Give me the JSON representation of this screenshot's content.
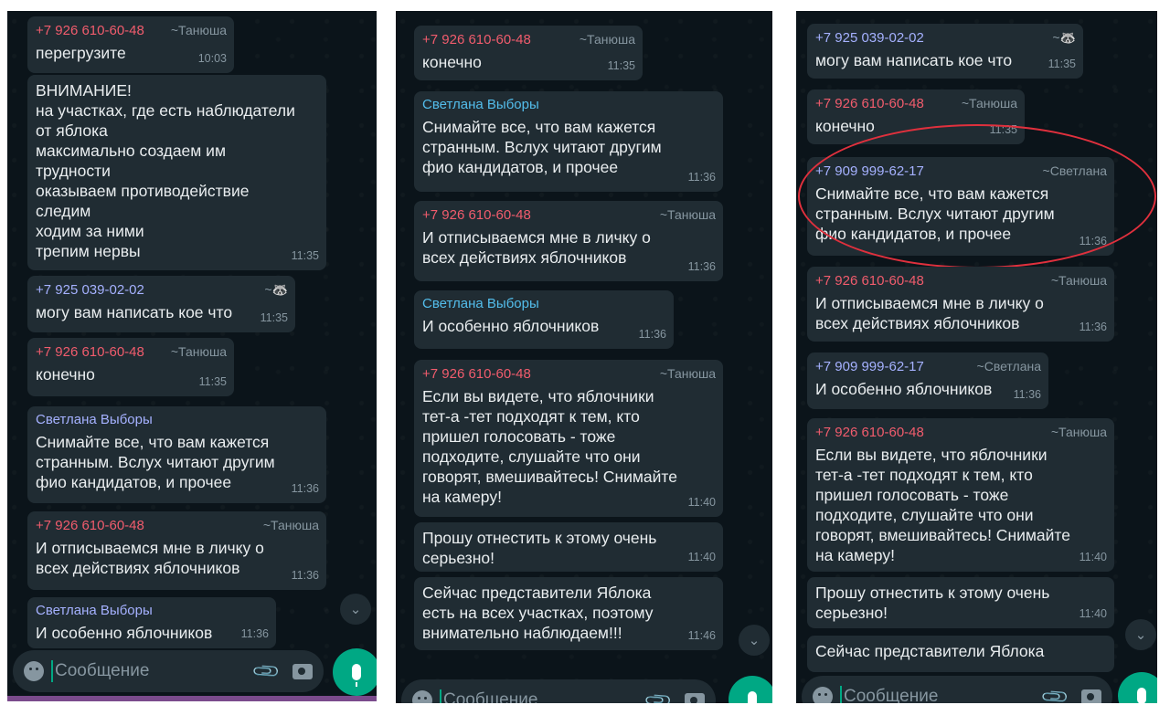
{
  "panels": [
    {
      "messages": [
        {
          "num": "+7 926 610-60-48",
          "alias": "~Танюша",
          "text": "перегрузите",
          "time": "10:03"
        },
        {
          "text": "ВНИМАНИЕ!\nна участках, где есть наблюдатели\nот яблока\nмаксимально создаем им\nтрудности\nоказываем противодействие\nследим\nходим за ними\nтрепим нервы",
          "time": "11:35"
        },
        {
          "num": "+7 925 039-02-02",
          "alias": "~🦝",
          "text": "могу вам написать кое что",
          "time": "11:35"
        },
        {
          "num": "+7 926 610-60-48",
          "alias": "~Танюша",
          "text": "конечно",
          "time": "11:35"
        },
        {
          "sender": "Светлана Выборы",
          "text": "Снимайте все, что вам кажется\nстранным. Вслух читают другим\nфио кандидатов, и прочее",
          "time": "11:36"
        },
        {
          "num": "+7 926 610-60-48",
          "alias": "~Танюша",
          "text": "И отписываемся мне в личку о\nвсех действиях яблочников",
          "time": "11:36"
        },
        {
          "sender": "Светлана Выборы",
          "text": "И особенно яблочников",
          "time": "11:36"
        }
      ],
      "input_placeholder": "Сообщение"
    },
    {
      "messages": [
        {
          "num": "+7 926 610-60-48",
          "alias": "~Танюша",
          "text": "конечно",
          "time": "11:35"
        },
        {
          "sender": "Светлана Выборы",
          "text": "Снимайте все, что вам кажется\nстранным. Вслух читают другим\nфио кандидатов, и прочее",
          "time": "11:36"
        },
        {
          "num": "+7 926 610-60-48",
          "alias": "~Танюша",
          "text": "И отписываемся мне в личку о\nвсех действиях яблочников",
          "time": "11:36"
        },
        {
          "sender": "Светлана Выборы",
          "text": "И особенно яблочников",
          "time": "11:36"
        },
        {
          "num": "+7 926 610-60-48",
          "alias": "~Танюша",
          "text": "Если вы видете, что яблочники\nтет-а -тет подходят к тем, кто\nпришел голосовать - тоже\nподходите, слушайте что они\nговорят, вмешивайтесь! Снимайте\nна камеру!",
          "time": "11:40"
        },
        {
          "text": "Прошу отнестить к этому очень\nсерьезно!",
          "time": "11:40"
        },
        {
          "text": "Сейчас представители Яблока\nесть на всех участках, поэтому\nвнимательно наблюдаем!!!",
          "time": "11:46"
        }
      ],
      "input_placeholder": "Сообщение"
    },
    {
      "messages": [
        {
          "num": "+7 925 039-02-02",
          "alias": "~🦝",
          "text": "могу вам написать кое что",
          "time": "11:35"
        },
        {
          "num": "+7 926 610-60-48",
          "alias": "~Танюша",
          "text": "конечно",
          "time": "11:35"
        },
        {
          "num": "+7 909 999-62-17",
          "alias": "~Светлана",
          "text": "Снимайте все, что вам кажется\nстранным. Вслух читают другим\nфио кандидатов, и прочее",
          "time": "11:36"
        },
        {
          "num": "+7 926 610-60-48",
          "alias": "~Танюша",
          "text": "И отписываемся мне в личку о\nвсех действиях яблочников",
          "time": "11:36"
        },
        {
          "num": "+7 909 999-62-17",
          "alias": "~Светлана",
          "text": "И особенно яблочников",
          "time": "11:36"
        },
        {
          "num": "+7 926 610-60-48",
          "alias": "~Танюша",
          "text": "Если вы видете, что яблочники\nтет-а -тет подходят к тем, кто\nпришел голосовать - тоже\nподходите, слушайте что они\nговорят, вмешивайтесь! Снимайте\nна камеру!",
          "time": "11:40"
        },
        {
          "text": "Прошу отнестить к этому очень\nсерьезно!",
          "time": "11:40"
        },
        {
          "text": "Сейчас представители Яблока",
          "time": ""
        }
      ],
      "input_placeholder": "Сообщение"
    }
  ]
}
